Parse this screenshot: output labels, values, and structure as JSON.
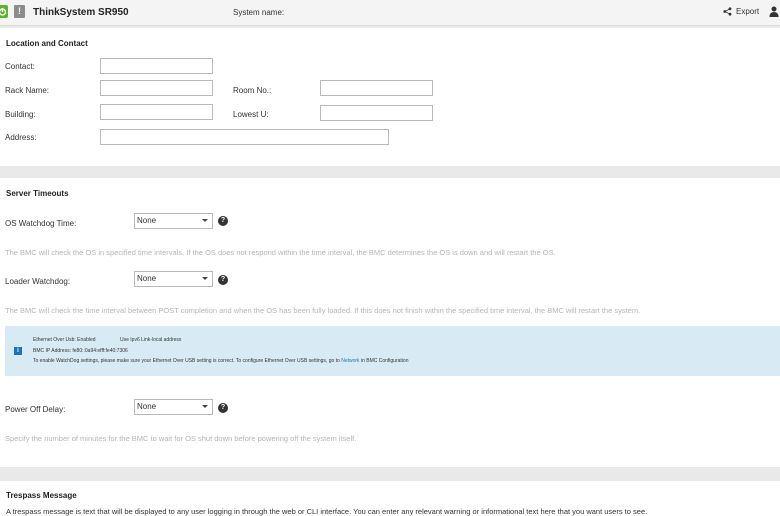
{
  "header": {
    "title": "ThinkSystem SR950",
    "warning_glyph": "!",
    "system_name_label": "System name:",
    "export_label": "Export"
  },
  "location": {
    "section_title": "Location and Contact",
    "contact_label": "Contact:",
    "rack_name_label": "Rack Name:",
    "room_no_label": "Room No.:",
    "building_label": "Building:",
    "lowest_u_label": "Lowest U:",
    "address_label": "Address:",
    "contact_value": "",
    "rack_name_value": "",
    "room_no_value": "",
    "building_value": "",
    "lowest_u_value": "",
    "address_value": ""
  },
  "timeouts": {
    "section_title": "Server Timeouts",
    "os_watchdog_label": "OS Watchdog Time:",
    "os_watchdog_value": "None",
    "os_watchdog_desc": "The BMC will check the OS in specified time intervals. If the OS does not respond within the time interval, the BMC determines the OS is down and will restart the OS.",
    "loader_watchdog_label": "Loader Watchdog:",
    "loader_watchdog_value": "None",
    "loader_watchdog_desc": "The BMC will check the time interval between POST completion and when the OS has been fully loaded. If this does not finish within the specified time interval, the BMC will restart the system.",
    "info": {
      "icon_glyph": "i",
      "ethernet_over_usb": "Ethernet Over Usb: Enabled",
      "ipv6_link_local": "Use Ipv6 Link-local address",
      "bmc_ip": "BMC IP Address: fe80::0a94:efff:fe40:7306",
      "note_prefix": "To enable WatchDog settings, please make sure your Ethernet Over USB setting is correct. To configure Ethernet Over USB settings, go to ",
      "note_link": "Network",
      "note_suffix": " in BMC Configuration"
    },
    "power_off_delay_label": "Power Off Delay:",
    "power_off_delay_value": "None",
    "power_off_delay_desc": "Specify the number of minutes for the BMC to wait for OS shut down before powering off the system itself."
  },
  "trespass": {
    "section_title": "Trespass Message",
    "description": "A trespass message is text that will be displayed to any user logging in through the web or CLI interface. You can enter any relevant warning or informational text here that you want users to see."
  },
  "colors": {
    "brand_green": "#5cb32e",
    "info_background": "#d8ebf5",
    "link_blue": "#1e73b8"
  }
}
